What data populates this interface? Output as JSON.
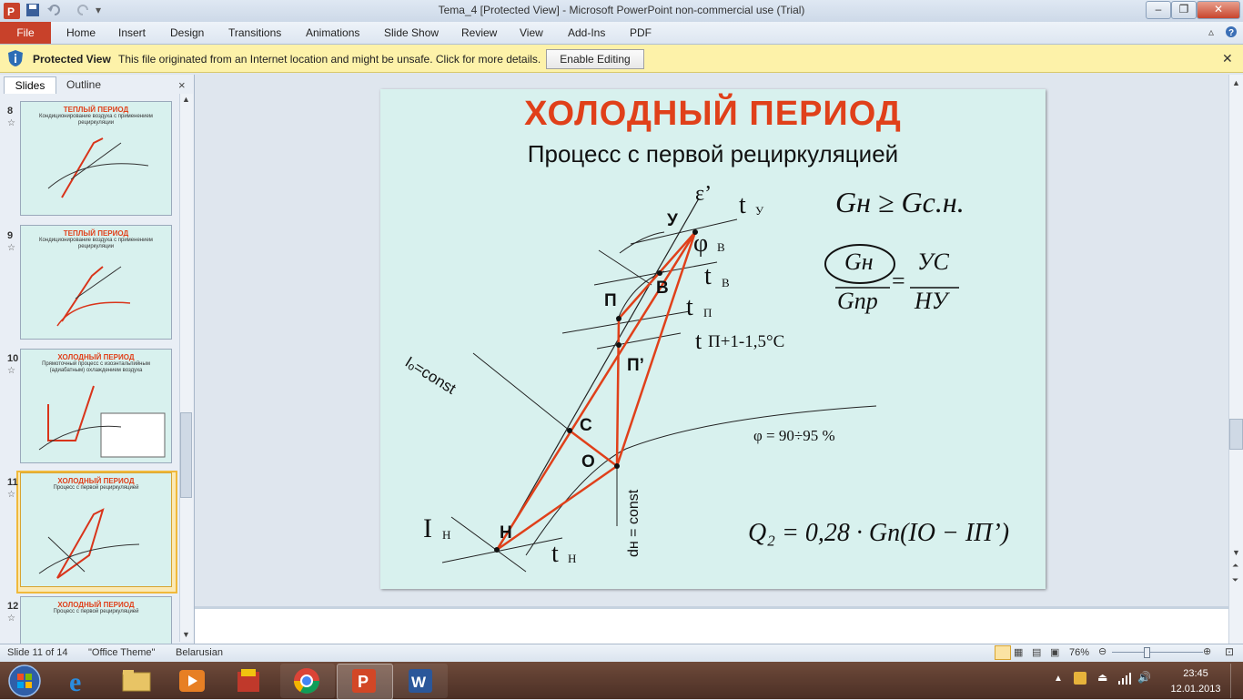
{
  "window": {
    "title": "Tema_4 [Protected View]  -  Microsoft PowerPoint non-commercial use (Trial)"
  },
  "ribbon": {
    "file": "File",
    "tabs": [
      "Home",
      "Insert",
      "Design",
      "Transitions",
      "Animations",
      "Slide Show",
      "Review",
      "View",
      "Add-Ins",
      "PDF"
    ]
  },
  "protected_view": {
    "title": "Protected View",
    "message": "This file originated from an Internet location and might be unsafe. Click for more details.",
    "button": "Enable Editing",
    "close": "✕"
  },
  "pane": {
    "tab_slides": "Slides",
    "tab_outline": "Outline",
    "close": "×",
    "thumbnails": [
      {
        "num": "8",
        "title": "ТЕПЛЫЙ ПЕРИОД",
        "subtitle": "Кондиционирование воздуха с применением рециркуляции"
      },
      {
        "num": "9",
        "title": "ТЕПЛЫЙ ПЕРИОД",
        "subtitle": "Кондиционирование воздуха с применением рециркуляции"
      },
      {
        "num": "10",
        "title": "ХОЛОДНЫЙ ПЕРИОД",
        "subtitle": "Прямоточный процесс с изоэнтальпийным (адиабатным) охлаждением воздуха"
      },
      {
        "num": "11",
        "title": "ХОЛОДНЫЙ ПЕРИОД",
        "subtitle": "Процесс с первой рециркуляцией"
      },
      {
        "num": "12",
        "title": "ХОЛОДНЫЙ ПЕРИОД",
        "subtitle": "Процесс с первой рециркуляцией"
      }
    ]
  },
  "slide": {
    "title": "ХОЛОДНЫЙ ПЕРИОД",
    "subtitle": "Процесс с первой рециркуляцией",
    "labels": {
      "eps": "ε’",
      "tu_t": "t",
      "tu_sub": "У",
      "y_point": "У",
      "phi_b": "φ",
      "phi_b_sub": "В",
      "tb_t": "t",
      "tb_sub": "В",
      "b_point": "В",
      "p_point": "П",
      "tp_t": "t",
      "tp_sub": "П",
      "tp_plus": "t",
      "tp_plus_sub": "П+1-1,5°С",
      "p_prime": "П’",
      "io_const": "Iₒ=const",
      "c_point": "С",
      "o_point": "О",
      "phi_range": "φ = 90÷95 %",
      "dn_const": "dн = const",
      "i_n": "I",
      "i_n_sub": "Н",
      "n_point": "Н",
      "tn_t": "t",
      "tn_sub": "Н"
    },
    "formulas": {
      "gn_ge": "Gн ≥ Gс.н.",
      "frac_num_left": "Gн",
      "frac_den_left": "Gпр",
      "equals": "=",
      "frac_num_right": "УС",
      "frac_den_right": "НУ",
      "q2": "Q₂ = 0,28 · Gп(IО − IП’)"
    }
  },
  "status": {
    "slide_info": "Slide 11 of 14",
    "theme": "\"Office Theme\"",
    "language": "Belarusian",
    "zoom": "76%"
  },
  "taskbar": {
    "time": "23:45",
    "date": "12.01.2013"
  }
}
